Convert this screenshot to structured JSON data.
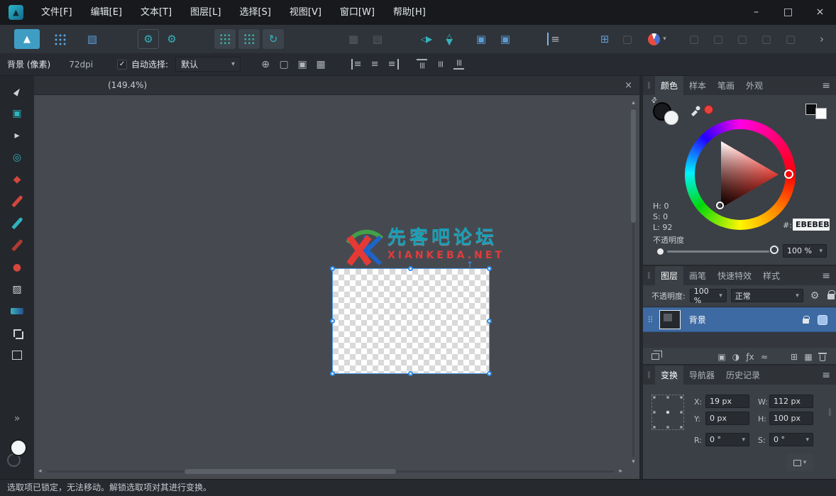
{
  "titlebar": {
    "menus": [
      "文件[F]",
      "编辑[E]",
      "文本[T]",
      "图层[L]",
      "选择[S]",
      "视图[V]",
      "窗口[W]",
      "帮助[H]"
    ]
  },
  "context_toolbar": {
    "doc_label": "背景 (像素)",
    "dpi": "72dpi",
    "auto_select_label": "自动选择:",
    "auto_select_value": "默认"
  },
  "canvas": {
    "tab_label": "(149.4%)",
    "logo_title": "先客吧论坛",
    "logo_subtitle": "XIANKEBA.NET"
  },
  "color_panel": {
    "tabs": [
      "颜色",
      "样本",
      "笔画",
      "外观"
    ],
    "h": "H: 0",
    "s": "S: 0",
    "l": "L: 92",
    "hex_label": "#:",
    "hex_value": "EBEBEB",
    "opacity_label": "不透明度",
    "opacity_value": "100 %"
  },
  "layers_panel": {
    "tabs": [
      "图层",
      "画笔",
      "快速特效",
      "样式"
    ],
    "opacity_label": "不透明度:",
    "opacity_value": "100 %",
    "blend_mode": "正常",
    "layer_name": "背景"
  },
  "transform_panel": {
    "tabs": [
      "变换",
      "导航器",
      "历史记录"
    ],
    "x_label": "X:",
    "x_value": "19 px",
    "y_label": "Y:",
    "y_value": "0 px",
    "w_label": "W:",
    "w_value": "112 px",
    "h_label": "H:",
    "h_value": "100 px",
    "r_label": "R:",
    "r_value": "0 °",
    "s_label": "S:",
    "s_value": "0 °"
  },
  "statusbar": {
    "message": "选取项已锁定，无法移动。解锁选取项对其进行变换。"
  },
  "colors": {
    "accent_teal": "#35B2BC",
    "accent_blue": "#5B9BD5",
    "selection_blue": "#2F8CEB",
    "layer_selected": "#3D6AA2",
    "hex_current": "#EBEBEB"
  },
  "icons": {
    "app": "▲",
    "minimize": "–",
    "maximize": "□",
    "close": "×",
    "gear": "⚙",
    "rotate": "↻",
    "grid": "▦",
    "grid_alt": "▤",
    "tri_left": "◁",
    "tri_right": "▶",
    "box": "▢",
    "box_filled": "▣",
    "box_diag": "▧",
    "bars": "≡",
    "grid_plus": "⊞",
    "caret": "▾",
    "caret_up": "▴",
    "caret_left": "◂",
    "caret_right": "▸",
    "overflow": "›",
    "target": "⊕",
    "menu": "≡",
    "grip": "∥",
    "drag_dots": "⠿",
    "cursor": "►",
    "arrow_small": "▸",
    "ring": "◎",
    "diamond": "◆",
    "dot": "●",
    "shade": "▨",
    "chevrons": "»",
    "up_arrow": "↑",
    "check": "✓",
    "swap": "⇄",
    "half": "◑",
    "fx": "ƒx",
    "wave": "≈"
  }
}
